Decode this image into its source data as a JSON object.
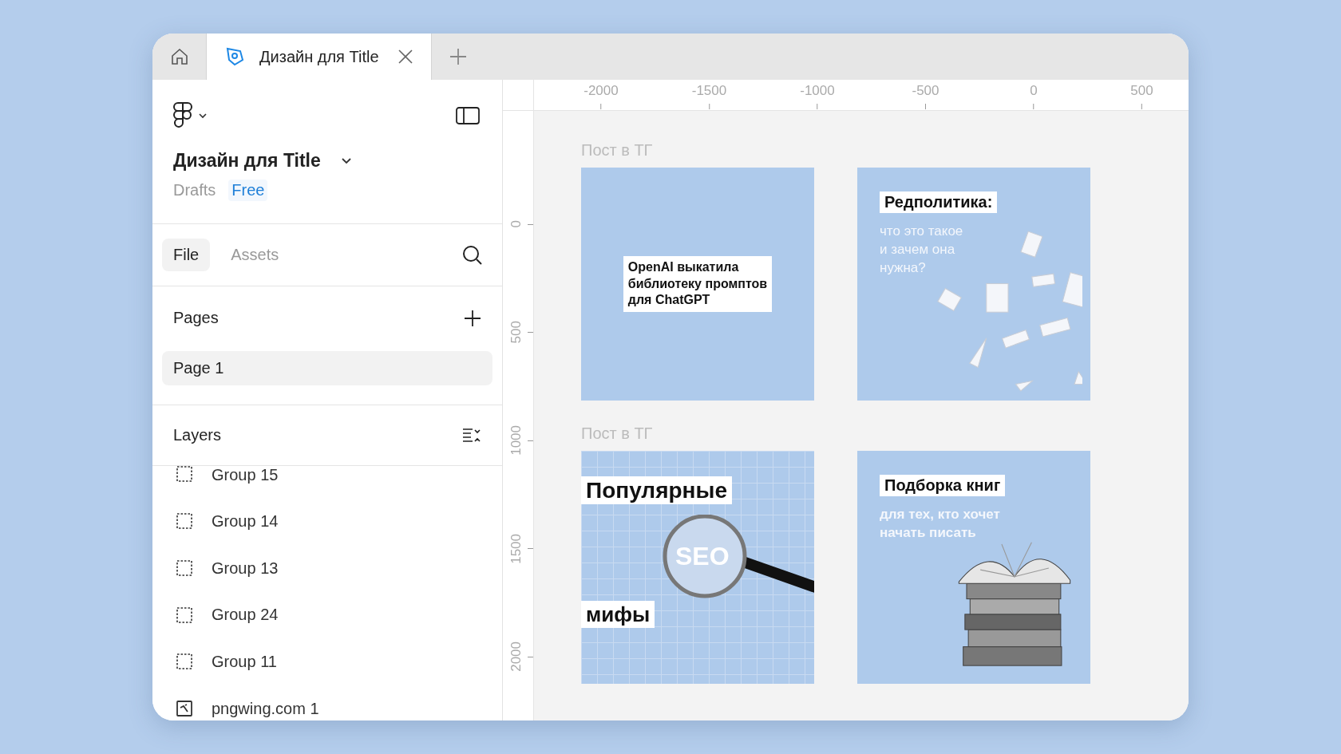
{
  "tabs": [
    {
      "kind": "home",
      "selected": false
    },
    {
      "kind": "file",
      "label": "Дизайн для Title",
      "selected": true
    }
  ],
  "file": {
    "title": "Дизайн для Title",
    "location": "Drafts",
    "plan": "Free"
  },
  "panel_tabs": [
    {
      "label": "File",
      "selected": true
    },
    {
      "label": "Assets",
      "selected": false
    }
  ],
  "pages": {
    "heading": "Pages",
    "items": [
      {
        "label": "Page 1",
        "selected": true
      }
    ]
  },
  "layers": {
    "heading": "Layers",
    "items": [
      {
        "label": "Group 15",
        "kind": "group"
      },
      {
        "label": "Group 14",
        "kind": "group"
      },
      {
        "label": "Group 13",
        "kind": "group"
      },
      {
        "label": "Group 24",
        "kind": "group"
      },
      {
        "label": "Group 11",
        "kind": "group"
      },
      {
        "label": "pngwing.com 1",
        "kind": "image"
      }
    ]
  },
  "canvas": {
    "h_ruler": [
      "-2000",
      "-1500",
      "-1000",
      "-500",
      "0",
      "500"
    ],
    "v_ruler": [
      "0",
      "500",
      "1000",
      "1500",
      "2000"
    ],
    "sections": [
      {
        "label": "Пост в ТГ",
        "frames": [
          {
            "kind": "boxed",
            "title": [
              "OpenAI выкатила",
              "библиотеку промптов",
              "для ChatGPT"
            ]
          },
          {
            "kind": "papers",
            "title": [
              "Редполитика:"
            ],
            "subtitle": [
              "что это такое",
              "и зачем она",
              "нужна?"
            ]
          }
        ]
      },
      {
        "label": "Пост в ТГ",
        "frames": [
          {
            "kind": "magnifier",
            "title": [
              "Популярные"
            ],
            "badge": "SEO",
            "bottom": "мифы"
          },
          {
            "kind": "books",
            "title": [
              "Подборка книг"
            ],
            "subtitle": [
              "для тех, кто хочет",
              "начать писать"
            ]
          }
        ]
      }
    ]
  }
}
